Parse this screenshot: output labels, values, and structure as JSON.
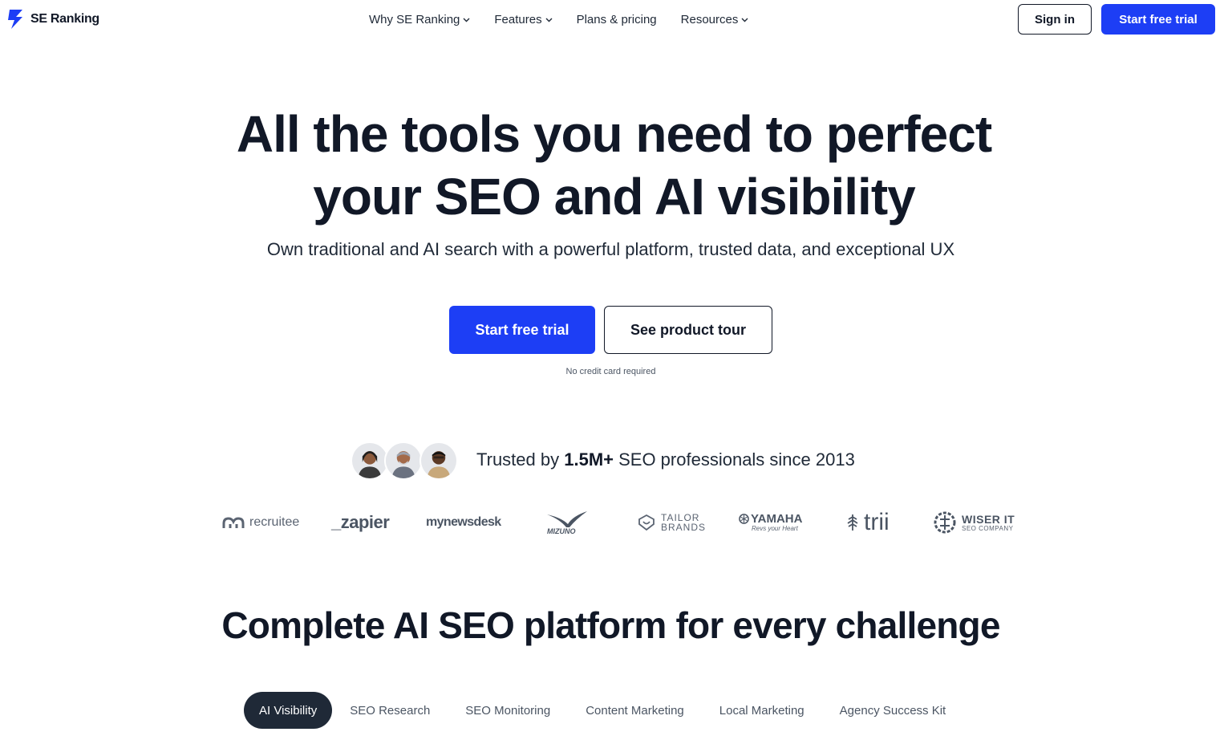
{
  "header": {
    "logo_text": "SE Ranking",
    "nav": [
      {
        "label": "Why SE Ranking",
        "has_dropdown": true
      },
      {
        "label": "Features",
        "has_dropdown": true
      },
      {
        "label": "Plans & pricing",
        "has_dropdown": false
      },
      {
        "label": "Resources",
        "has_dropdown": true
      }
    ],
    "sign_in_label": "Sign in",
    "start_trial_label": "Start free trial"
  },
  "hero": {
    "title_line1": "All the tools you need to perfect",
    "title_line2": "your SEO and AI visibility",
    "subtitle": "Own traditional and AI search with a powerful platform, trusted data, and exceptional UX",
    "primary_cta": "Start free trial",
    "secondary_cta": "See product tour",
    "note": "No credit card required"
  },
  "trusted": {
    "prefix": "Trusted by ",
    "count": "1.5M+",
    "suffix": " SEO professionals since 2013"
  },
  "brands": {
    "recruitee": "recruitee",
    "zapier": "_zapier",
    "mynewsdesk": "mynewsdesk",
    "mizuno": "Mizuno",
    "tailor_line1": "TAILOR",
    "tailor_line2": "BRANDS",
    "yamaha": "YAMAHA",
    "yamaha_tag": "Revs your Heart",
    "trii": "trii",
    "wiser_line1": "WISER IT",
    "wiser_line2": "SEO COMPANY"
  },
  "section": {
    "title": "Complete AI SEO platform for every challenge",
    "tabs": [
      {
        "label": "AI Visibility",
        "active": true
      },
      {
        "label": "SEO Research",
        "active": false
      },
      {
        "label": "SEO Monitoring",
        "active": false
      },
      {
        "label": "Content Marketing",
        "active": false
      },
      {
        "label": "Local Marketing",
        "active": false
      },
      {
        "label": "Agency Success Kit",
        "active": false
      }
    ]
  },
  "colors": {
    "brand_blue": "#1d3ef5",
    "dark": "#111827",
    "active_tab": "#1f2937"
  }
}
